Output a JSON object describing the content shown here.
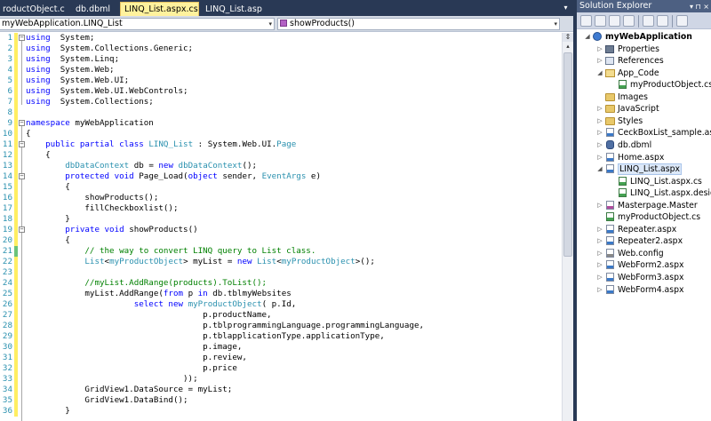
{
  "tabs": [
    {
      "label": "roductObject.cs",
      "active": false
    },
    {
      "label": "db.dbml",
      "active": false
    },
    {
      "label": "LINQ_List.aspx.cs",
      "active": true
    },
    {
      "label": "LINQ_List.aspx",
      "active": false
    }
  ],
  "tab_strip": {
    "dropdown_glyph": "▾",
    "close_glyph": "×"
  },
  "navbar": {
    "type_combo": "myWebApplication.LINQ_List",
    "member_combo": "showProducts()",
    "combo_arrow": "▾",
    "split_glyph": "⇕"
  },
  "scrollbar": {
    "split_glyph": "⇕",
    "up_glyph": "▴"
  },
  "code": {
    "lines": [
      {
        "n": "1",
        "segs": [
          [
            "kw",
            "using"
          ],
          [
            "",
            "  System;"
          ]
        ],
        "box": "−"
      },
      {
        "n": "2",
        "segs": [
          [
            "kw",
            "using"
          ],
          [
            "",
            "  System.Collections.Generic;"
          ]
        ]
      },
      {
        "n": "3",
        "segs": [
          [
            "kw",
            "using"
          ],
          [
            "",
            "  System.Linq;"
          ]
        ]
      },
      {
        "n": "4",
        "segs": [
          [
            "kw",
            "using"
          ],
          [
            "",
            "  System.Web;"
          ]
        ]
      },
      {
        "n": "5",
        "segs": [
          [
            "kw",
            "using"
          ],
          [
            "",
            "  System.Web.UI;"
          ]
        ]
      },
      {
        "n": "6",
        "segs": [
          [
            "kw",
            "using"
          ],
          [
            "",
            "  System.Web.UI.WebControls;"
          ]
        ]
      },
      {
        "n": "7",
        "segs": [
          [
            "kw",
            "using"
          ],
          [
            "",
            "  System.Collections;"
          ]
        ]
      },
      {
        "n": "8",
        "segs": []
      },
      {
        "n": "9",
        "segs": [
          [
            "kw",
            "namespace"
          ],
          [
            "",
            " myWebApplication"
          ]
        ],
        "box": "−"
      },
      {
        "n": "10",
        "segs": [
          [
            "",
            "{"
          ]
        ]
      },
      {
        "n": "11",
        "segs": [
          [
            "",
            "    "
          ],
          [
            "kw",
            "public partial class"
          ],
          [
            "",
            " "
          ],
          [
            "ty",
            "LINQ_List"
          ],
          [
            "",
            " : System.Web.UI."
          ],
          [
            "ty",
            "Page"
          ]
        ],
        "box": "−"
      },
      {
        "n": "12",
        "segs": [
          [
            "",
            "    {"
          ]
        ]
      },
      {
        "n": "13",
        "segs": [
          [
            "",
            "        "
          ],
          [
            "ty",
            "dbDataContext"
          ],
          [
            "",
            " db = "
          ],
          [
            "kw",
            "new"
          ],
          [
            "",
            " "
          ],
          [
            "ty",
            "dbDataContext"
          ],
          [
            "",
            "();"
          ]
        ]
      },
      {
        "n": "14",
        "segs": [
          [
            "",
            "        "
          ],
          [
            "kw",
            "protected void"
          ],
          [
            "",
            " Page_Load("
          ],
          [
            "kw",
            "object"
          ],
          [
            "",
            " sender, "
          ],
          [
            "ty",
            "EventArgs"
          ],
          [
            "",
            " e)"
          ]
        ],
        "box": "−"
      },
      {
        "n": "15",
        "segs": [
          [
            "",
            "        {"
          ]
        ]
      },
      {
        "n": "16",
        "segs": [
          [
            "",
            "            showProducts();"
          ]
        ]
      },
      {
        "n": "17",
        "segs": [
          [
            "",
            "            fillCheckboxlist();"
          ]
        ]
      },
      {
        "n": "18",
        "segs": [
          [
            "",
            "        }"
          ]
        ]
      },
      {
        "n": "19",
        "segs": [
          [
            "",
            "        "
          ],
          [
            "kw",
            "private void"
          ],
          [
            "",
            " showProducts()"
          ]
        ],
        "box": "−"
      },
      {
        "n": "20",
        "segs": [
          [
            "",
            "        {"
          ]
        ]
      },
      {
        "n": "21",
        "segs": [
          [
            "",
            "            "
          ],
          [
            "cm",
            "// the way to convert LINQ query to List class."
          ]
        ],
        "chg": "green"
      },
      {
        "n": "22",
        "segs": [
          [
            "",
            "            "
          ],
          [
            "ty",
            "List"
          ],
          [
            "",
            "<"
          ],
          [
            "ty",
            "myProductObject"
          ],
          [
            "",
            "> myList = "
          ],
          [
            "kw",
            "new"
          ],
          [
            "",
            " "
          ],
          [
            "ty",
            "List"
          ],
          [
            "",
            "<"
          ],
          [
            "ty",
            "myProductObject"
          ],
          [
            "",
            ">();"
          ]
        ]
      },
      {
        "n": "23",
        "segs": []
      },
      {
        "n": "24",
        "segs": [
          [
            "",
            "            "
          ],
          [
            "cm",
            "//myList.AddRange(products).ToList();"
          ]
        ]
      },
      {
        "n": "25",
        "segs": [
          [
            "",
            "            myList.AddRange("
          ],
          [
            "kw",
            "from"
          ],
          [
            "",
            " p "
          ],
          [
            "kw",
            "in"
          ],
          [
            "",
            " db.tblmyWebsites"
          ]
        ]
      },
      {
        "n": "26",
        "segs": [
          [
            "",
            "                      "
          ],
          [
            "kw",
            "select new"
          ],
          [
            "",
            " "
          ],
          [
            "ty",
            "myProductObject"
          ],
          [
            "",
            "( p.Id,"
          ]
        ]
      },
      {
        "n": "27",
        "segs": [
          [
            "",
            "                                    p.productName,"
          ]
        ]
      },
      {
        "n": "28",
        "segs": [
          [
            "",
            "                                    p.tblprogrammingLanguage.programmingLanguage,"
          ]
        ]
      },
      {
        "n": "29",
        "segs": [
          [
            "",
            "                                    p.tblapplicationType.applicationType,"
          ]
        ]
      },
      {
        "n": "30",
        "segs": [
          [
            "",
            "                                    p.image,"
          ]
        ]
      },
      {
        "n": "31",
        "segs": [
          [
            "",
            "                                    p.review,"
          ]
        ]
      },
      {
        "n": "32",
        "segs": [
          [
            "",
            "                                    p.price"
          ]
        ]
      },
      {
        "n": "33",
        "segs": [
          [
            "",
            "                                ));"
          ]
        ]
      },
      {
        "n": "34",
        "segs": [
          [
            "",
            "            GridView1.DataSource = myList;"
          ]
        ]
      },
      {
        "n": "35",
        "segs": [
          [
            "",
            "            GridView1.DataBind();"
          ]
        ]
      },
      {
        "n": "36",
        "segs": [
          [
            "",
            "        }"
          ]
        ]
      }
    ]
  },
  "solution_explorer": {
    "title": "Solution Explorer",
    "title_buttons": "▾ ⊓ ×",
    "tree": [
      {
        "label": "myWebApplication",
        "depth": 0,
        "exp": "◢",
        "icon": "project",
        "bold": true
      },
      {
        "label": "Properties",
        "depth": 1,
        "exp": "▷",
        "icon": "props"
      },
      {
        "label": "References",
        "depth": 1,
        "exp": "▷",
        "icon": "refs"
      },
      {
        "label": "App_Code",
        "depth": 1,
        "exp": "◢",
        "icon": "folder-open"
      },
      {
        "label": "myProductObject.cs",
        "depth": 2,
        "exp": "",
        "icon": "cs"
      },
      {
        "label": "Images",
        "depth": 1,
        "exp": "",
        "icon": "folder"
      },
      {
        "label": "JavaScript",
        "depth": 1,
        "exp": "▷",
        "icon": "folder"
      },
      {
        "label": "Styles",
        "depth": 1,
        "exp": "▷",
        "icon": "folder"
      },
      {
        "label": "CeckBoxList_sample.aspx",
        "depth": 1,
        "exp": "▷",
        "icon": "aspx"
      },
      {
        "label": "db.dbml",
        "depth": 1,
        "exp": "▷",
        "icon": "dbml"
      },
      {
        "label": "Home.aspx",
        "depth": 1,
        "exp": "▷",
        "icon": "aspx"
      },
      {
        "label": "LINQ_List.aspx",
        "depth": 1,
        "exp": "◢",
        "icon": "aspx",
        "selected": true
      },
      {
        "label": "LINQ_List.aspx.cs",
        "depth": 2,
        "exp": "",
        "icon": "cs"
      },
      {
        "label": "LINQ_List.aspx.designer.",
        "depth": 2,
        "exp": "",
        "icon": "cs"
      },
      {
        "label": "Masterpage.Master",
        "depth": 1,
        "exp": "▷",
        "icon": "master"
      },
      {
        "label": "myProductObject.cs",
        "depth": 1,
        "exp": "",
        "icon": "cs"
      },
      {
        "label": "Repeater.aspx",
        "depth": 1,
        "exp": "▷",
        "icon": "aspx"
      },
      {
        "label": "Repeater2.aspx",
        "depth": 1,
        "exp": "▷",
        "icon": "aspx"
      },
      {
        "label": "Web.config",
        "depth": 1,
        "exp": "▷",
        "icon": "config"
      },
      {
        "label": "WebForm2.aspx",
        "depth": 1,
        "exp": "▷",
        "icon": "aspx"
      },
      {
        "label": "WebForm3.aspx",
        "depth": 1,
        "exp": "▷",
        "icon": "aspx"
      },
      {
        "label": "WebForm4.aspx",
        "depth": 1,
        "exp": "▷",
        "icon": "aspx"
      }
    ]
  }
}
